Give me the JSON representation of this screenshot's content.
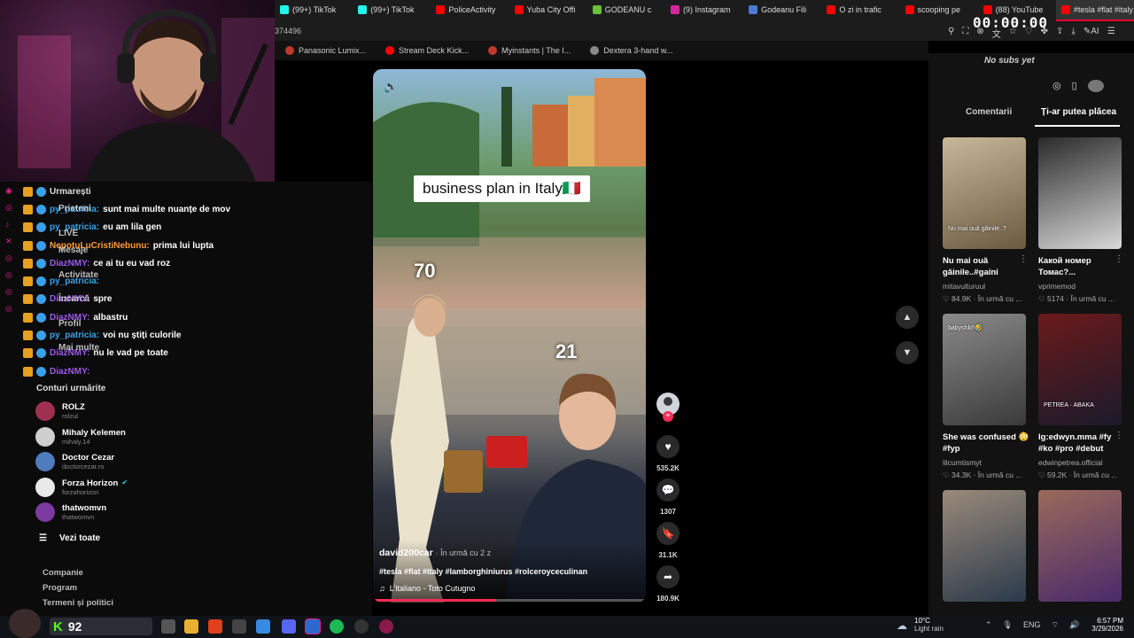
{
  "browser": {
    "tabs": [
      {
        "label": "(99+) TikTok",
        "color": "#25f4ee"
      },
      {
        "label": "(99+) TikTok",
        "color": "#25f4ee"
      },
      {
        "label": "PoliceActivity",
        "color": "#ff0000"
      },
      {
        "label": "Yuba City Offi",
        "color": "#ff0000"
      },
      {
        "label": "GODEANU c",
        "color": "#6bbf3a"
      },
      {
        "label": "(9) Instagram",
        "color": "#d6249f"
      },
      {
        "label": "Godeanu Fili",
        "color": "#4a7bd0"
      },
      {
        "label": "O zi in trafic",
        "color": "#ff0000"
      },
      {
        "label": "scooping pe",
        "color": "#ff0000"
      },
      {
        "label": "(88) YouTube",
        "color": "#ff0000"
      },
      {
        "label": "#tesla #flat #italy",
        "color": "#ff0000"
      }
    ],
    "address_fragment": "374496",
    "bookmarks": [
      {
        "label": "Panasonic Lumix...",
        "color": "#c0392b"
      },
      {
        "label": "Stream Deck Kick...",
        "color": "#ff0000"
      },
      {
        "label": "Myinstants | The I...",
        "color": "#c0392b"
      },
      {
        "label": "Dextera 3-hand w...",
        "color": "#888888"
      }
    ],
    "timer": "00:00:00",
    "no_subs": "No subs yet"
  },
  "chat": {
    "rows": [
      {
        "user": "Urmarești",
        "msg": "",
        "color": "#dddddd"
      },
      {
        "user": "py_patricia:",
        "msg": "sunt mai multe nuanțe de mov",
        "color": "#3aa0e8"
      },
      {
        "user": "py_patricia:",
        "msg": "eu am lila gen",
        "color": "#3aa0e8"
      },
      {
        "user": "NepotuLuCristiNebunu:",
        "msg": "prima lui lupta",
        "color": "#ff9a3c"
      },
      {
        "user": "DiazNMY:",
        "msg": "ce ai tu eu vad roz",
        "color": "#9b59e8"
      },
      {
        "user": "py_patricia:",
        "msg": "",
        "color": "#3aa0e8"
      },
      {
        "user": "DiazNMY:",
        "msg": "spre",
        "color": "#9b59e8"
      },
      {
        "user": "DiazNMY:",
        "msg": "albastru",
        "color": "#9b59e8"
      },
      {
        "user": "py_patricia:",
        "msg": "voi nu știți culorile",
        "color": "#3aa0e8"
      },
      {
        "user": "DiazNMY:",
        "msg": "nu le vad pe toate",
        "color": "#9b59e8"
      },
      {
        "user": "DiazNMY:",
        "msg": "",
        "color": "#9b59e8"
      }
    ],
    "nav_overlay": [
      "Prieteni",
      "LIVE",
      "Mesaje",
      "Activitate",
      "Încarcă",
      "Profil",
      "Mai multe"
    ]
  },
  "following": {
    "title": "Conturi urmărite",
    "accounts": [
      {
        "name": "ROLZ",
        "handle": "rolzul",
        "color": "#a03050",
        "verified": false
      },
      {
        "name": "Mihaly Kelemen",
        "handle": "mihaly.14",
        "color": "#cfcfcf",
        "verified": false
      },
      {
        "name": "Doctor Cezar",
        "handle": "doctorcezar.ro",
        "color": "#4f7bbf",
        "verified": false
      },
      {
        "name": "Forza Horizon",
        "handle": "forzahorizon",
        "color": "#e9e9e9",
        "verified": true
      },
      {
        "name": "thatwomvn",
        "handle": "thatwomvn",
        "color": "#7a3aa0",
        "verified": false
      }
    ],
    "see_all": "Vezi toate"
  },
  "footer_links": [
    "Companie",
    "Program",
    "Termeni și politici"
  ],
  "video": {
    "caption": "business plan in Italy🇮🇹",
    "overlay_numbers": [
      "70",
      "21"
    ],
    "author": "david200car",
    "time_ago": "· În urmă cu 2 z",
    "hashtags": "#tesla #flat #italy #lamborghiniurus #rolceroyceculinan",
    "music": "L'italiano - Toto Cutugno",
    "progress": 0.45
  },
  "actions": {
    "likes": "535.2K",
    "comments": "1307",
    "saves": "31.1K",
    "shares": "180.9K"
  },
  "right_panel": {
    "tabs": [
      "Comentarii",
      "Ți-ar putea plăcea"
    ],
    "active_tab": 1,
    "videos": [
      {
        "title": "Nu mai ouă găinile..#gaini",
        "user": "mitavulturuul",
        "views": "84.9K",
        "ago": "În urmă cu ...",
        "thumb_text": "Nu mai ouă găinile..?",
        "c1": "#6a5a40",
        "c2": "#c8b89a"
      },
      {
        "title": "Какой номер Томас?...",
        "user": "vprimemod",
        "views": "5174",
        "ago": "În urmă cu ...",
        "thumb_text": "",
        "c1": "#d9d9d9",
        "c2": "#2a2a2a"
      },
      {
        "title": "She was confused 😳 #fyp",
        "user": "lilcumtismyt",
        "views": "34.3K",
        "ago": "În urmă cu ...",
        "thumb_text": "babyshk!!🤣",
        "c1": "#3a3a3a",
        "c2": "#8a8a8a"
      },
      {
        "title": "lg:edwyn.mma #fy #ko #pro #debut",
        "user": "edwinpetrea.official",
        "views": "59.2K",
        "ago": "În urmă cu ...",
        "thumb_text": "PETREA · ABAKA",
        "c1": "#1a1a2a",
        "c2": "#6a1a1a"
      },
      {
        "title": "",
        "user": "",
        "views": "",
        "ago": "",
        "thumb_text": "",
        "c1": "#2a3a4a",
        "c2": "#9a8a7a"
      },
      {
        "title": "",
        "user": "",
        "views": "",
        "ago": "",
        "thumb_text": "",
        "c1": "#4a2a6a",
        "c2": "#9a6a5a"
      }
    ]
  },
  "taskbar": {
    "score": "92",
    "weather_temp": "10°C",
    "weather_desc": "Light rain",
    "lang": "ENG",
    "time": "6:57 PM",
    "date": "3/29/2026"
  }
}
